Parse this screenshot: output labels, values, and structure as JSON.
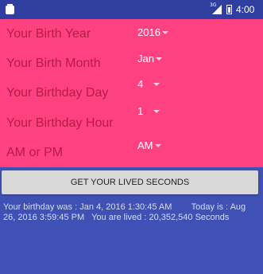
{
  "status_bar": {
    "network_label": "3G",
    "time": "4:00",
    "icons": [
      "notification-icon",
      "signal-icon",
      "battery-icon"
    ]
  },
  "colors": {
    "form_background": "#ff4081",
    "app_background": "#3f51b5",
    "status_bar": "#303f9f",
    "label_text": "#b41d47",
    "button_background": "#d8d8d8"
  },
  "form": {
    "fields": [
      {
        "label": "Your Birth Year",
        "value": "2016"
      },
      {
        "label": "Your Birth Month",
        "value": "Jan"
      },
      {
        "label": "Your Birthday Day",
        "value": "4"
      },
      {
        "label": "Your Birthday Hour",
        "value": "1"
      },
      {
        "label": "AM or PM",
        "value": "AM"
      }
    ]
  },
  "action": {
    "button_label": "GET YOUR LIVED SECONDS"
  },
  "result": {
    "text": "Your birthday was : Jan 4, 2016 1:30:45 AM        Today is : Aug 26, 2016 3:59:45 PM   You are lived : 20,352,540 Seconds"
  }
}
